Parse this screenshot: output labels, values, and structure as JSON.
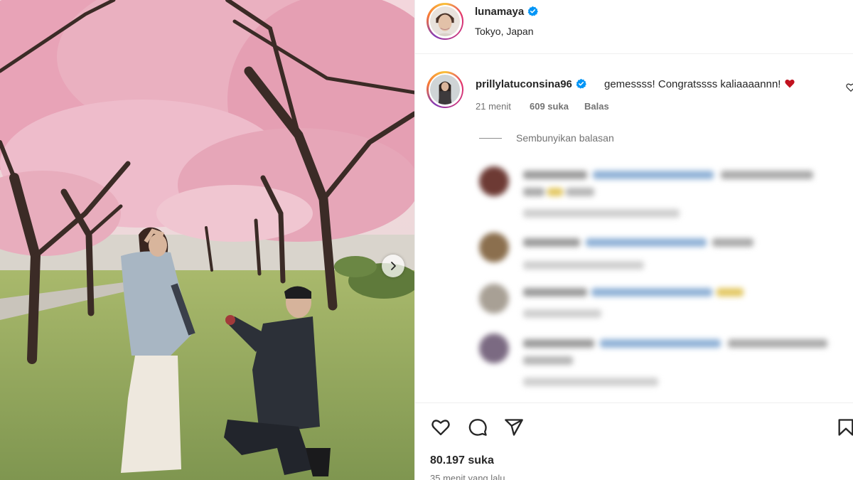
{
  "post": {
    "author": "lunamaya",
    "author_verified": true,
    "location": "Tokyo, Japan",
    "likes": "80.197 suka",
    "time_ago": "35 menit yang lalu"
  },
  "comment": {
    "username": "prillylatuconsina96",
    "verified": true,
    "text": "gemessss! Congratssss kaliaaaannn!",
    "emoji": "red-heart",
    "time": "21 menit",
    "likes": "609 suka",
    "reply_label": "Balas",
    "hide_replies_label": "Sembunyikan balasan"
  },
  "icons": {
    "like": "heart-icon",
    "comment": "comment-icon",
    "share": "send-icon",
    "save": "bookmark-icon",
    "carousel_next": "chevron-right-icon",
    "verified": "verified-badge-icon"
  },
  "colors": {
    "verified_blue": "#0095f6",
    "heart_red": "#c1121f",
    "secondary_text": "#737373"
  }
}
